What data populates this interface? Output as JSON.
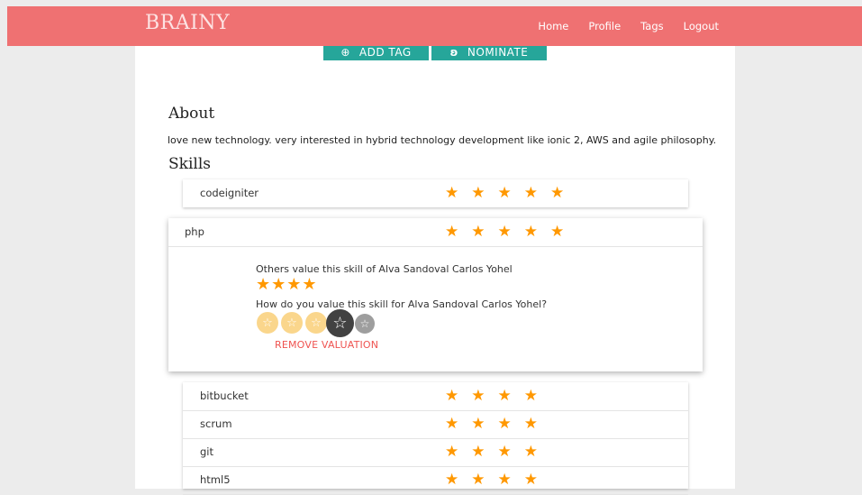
{
  "app": {
    "brand": "BRAINY",
    "nav": [
      "Home",
      "Profile",
      "Tags",
      "Logout"
    ],
    "colors": {
      "header": "#ef7172",
      "accent_button": "#26a69a",
      "star": "#ff9800",
      "remove": "#ef5350"
    }
  },
  "actions": {
    "add_tag": {
      "icon": "add-circle-icon",
      "label": "ADD TAG"
    },
    "nominate": {
      "icon": "nominate-icon",
      "label": "NOMINATE"
    }
  },
  "about": {
    "title": "About",
    "text": "love new technology. very interested in hybrid technology development like ionic 2, AWS and agile philosophy."
  },
  "skills": {
    "title": "Skills",
    "items": [
      {
        "name": "codeigniter",
        "stars": "★★★★★",
        "rating": 5
      },
      {
        "name": "php",
        "stars": "★★★★★",
        "rating": 5
      },
      {
        "name": "bitbucket",
        "stars": "★★★★",
        "rating": 4
      },
      {
        "name": "scrum",
        "stars": "★★★★",
        "rating": 4
      },
      {
        "name": "git",
        "stars": "★★★★",
        "rating": 4
      },
      {
        "name": "html5",
        "stars": "★★★★",
        "rating": 4
      }
    ]
  },
  "expanded": {
    "others_label": "Others value this skill of Alva Sandoval Carlos Yohel",
    "others_stars": "★★★★",
    "others_rating": 4,
    "ask_label": "How do you value this skill for Alva Sandoval Carlos Yohel?",
    "rate_glyph": "☆",
    "user_rating": 4,
    "remove_label": "REMOVE VALUATION"
  }
}
